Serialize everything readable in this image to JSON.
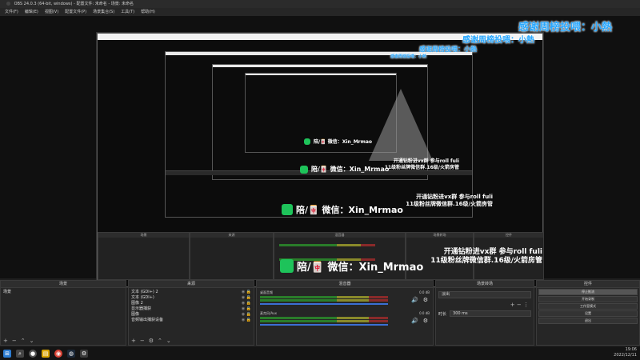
{
  "window": {
    "title": "OBS 24.0.3 (64-bit, windows) - 配置文件: 未命名 - 场景: 未命名"
  },
  "menu": [
    "文件(F)",
    "编辑(E)",
    "视图(V)",
    "配置文件(P)",
    "场景集合(S)",
    "工具(T)",
    "帮助(H)"
  ],
  "overlay": {
    "thanks": "感谢周榜投喂：小熱",
    "wechat": "陪/🀄 微信：Xin_Mrmao",
    "promo_line1": "开通钻粉进vx群 参与roll fuli",
    "promo_line2": "11级粉丝牌微信群.16级/火箭房管"
  },
  "docks": {
    "scenes": {
      "title": "场景",
      "items": [
        "场景"
      ]
    },
    "sources": {
      "title": "来源",
      "items": [
        "文本 (GDI+) 2",
        "文本 (GDI+)",
        "图像 2",
        "显示器捕获",
        "图像",
        "音频输出捕获设备"
      ]
    },
    "mixer": {
      "title": "混音器",
      "channels": [
        {
          "name": "桌面音频",
          "db": "0.0 dB"
        },
        {
          "name": "麦克风/Aux",
          "db": "0.0 dB"
        }
      ]
    },
    "transitions": {
      "title": "场景转场",
      "type": "淡出",
      "duration_label": "时长",
      "duration": "300 ms"
    },
    "controls": {
      "title": "控件",
      "buttons": [
        "停止推流",
        "开始录制",
        "工作室模式",
        "设置",
        "退出"
      ]
    }
  },
  "taskbar": {
    "time": "19:06",
    "date": "2022/12/11"
  },
  "icons": [
    "windows-icon",
    "search-icon",
    "obs-icon",
    "chrome-icon",
    "steam-icon",
    "folder-icon",
    "gear-icon"
  ]
}
